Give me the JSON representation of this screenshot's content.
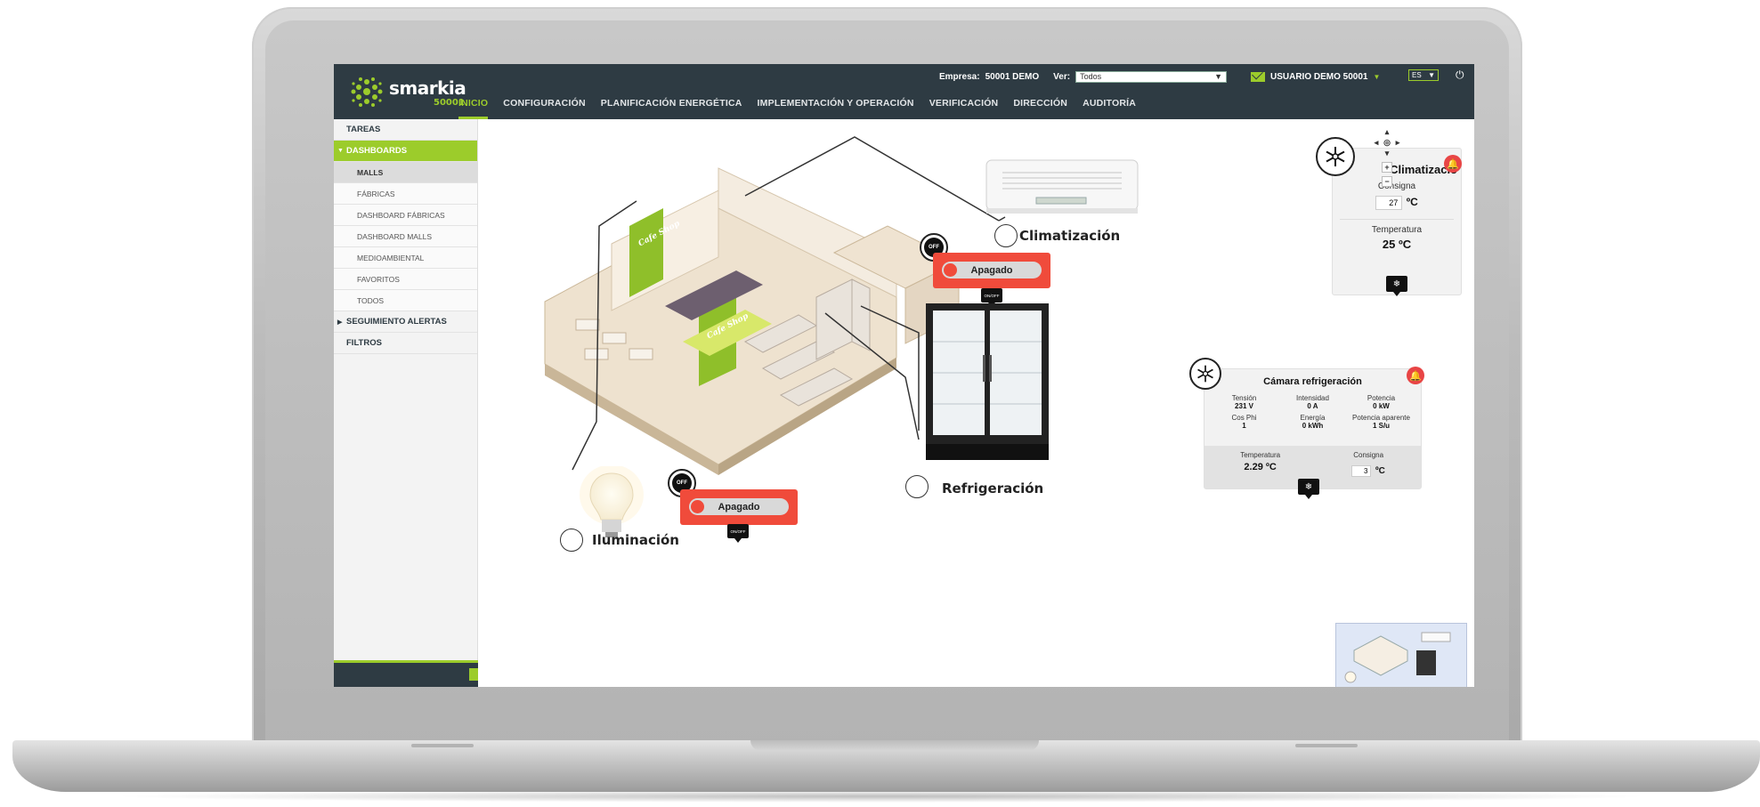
{
  "header": {
    "logo_word": "smarkia",
    "logo_sub": "50001",
    "company_label": "Empresa:",
    "company_value": "50001 DEMO",
    "view_label": "Ver:",
    "view_value": "Todos",
    "user": "USUARIO DEMO 50001",
    "language": "ES",
    "nav": [
      "INICIO",
      "CONFIGURACIÓN",
      "PLANIFICACIÓN ENERGÉTICA",
      "IMPLEMENTACIÓN Y OPERACIÓN",
      "VERIFICACIÓN",
      "DIRECCIÓN",
      "AUDITORÍA"
    ]
  },
  "sidebar": {
    "items": [
      {
        "label": "TAREAS"
      },
      {
        "label": "DASHBOARDS"
      },
      {
        "label": "MALLS"
      },
      {
        "label": "FÁBRICAS"
      },
      {
        "label": "DASHBOARD FÁBRICAS"
      },
      {
        "label": "DASHBOARD MALLS"
      },
      {
        "label": "MEDIOAMBIENTAL"
      },
      {
        "label": "FAVORITOS"
      },
      {
        "label": "TODOS"
      },
      {
        "label": "SEGUIMIENTO ALERTAS"
      },
      {
        "label": "FILTROS"
      }
    ]
  },
  "scene": {
    "store_signs": [
      "Cafe Shop",
      "Cafe Shop"
    ],
    "labels": {
      "climatizacion": "Climatización",
      "refrigeracion": "Refrigeración",
      "iluminacion": "Iluminación"
    },
    "switch_climatizacion": {
      "state": "Apagado",
      "badge": "OFF",
      "tag": "ON/OFF"
    },
    "switch_iluminacion": {
      "state": "Apagado",
      "badge": "OFF",
      "tag": "ON/OFF"
    }
  },
  "climate_panel": {
    "title": "Climatizació",
    "setpoint_label": "Consigna",
    "setpoint_value": "27",
    "setpoint_unit": "ºC",
    "temp_label": "Temperatura",
    "temp_value": "25 ºC"
  },
  "fridge_panel": {
    "title": "Cámara refrigeración",
    "metrics": [
      {
        "label": "Tensión",
        "value": "231 V"
      },
      {
        "label": "Intensidad",
        "value": "0 A"
      },
      {
        "label": "Potencia",
        "value": "0 kW"
      },
      {
        "label": "Cos Phi",
        "value": "1"
      },
      {
        "label": "Energía",
        "value": "0 kWh"
      },
      {
        "label": "Potencia aparente",
        "value": "1 S/u"
      }
    ],
    "temp_label": "Temperatura",
    "temp_value": "2.29 ºC",
    "setpoint_label": "Consigna",
    "setpoint_value": "3",
    "setpoint_unit": "ºC"
  },
  "map_controls": {
    "zoom_in": "+",
    "zoom_out": "−"
  },
  "colors": {
    "accent": "#9ccc2b",
    "topbar": "#2e3b43",
    "alert": "#f04b3b"
  },
  "icons": [
    "snowflake-icon",
    "bell-icon",
    "power-icon",
    "mail-icon",
    "chevron-down-icon"
  ]
}
